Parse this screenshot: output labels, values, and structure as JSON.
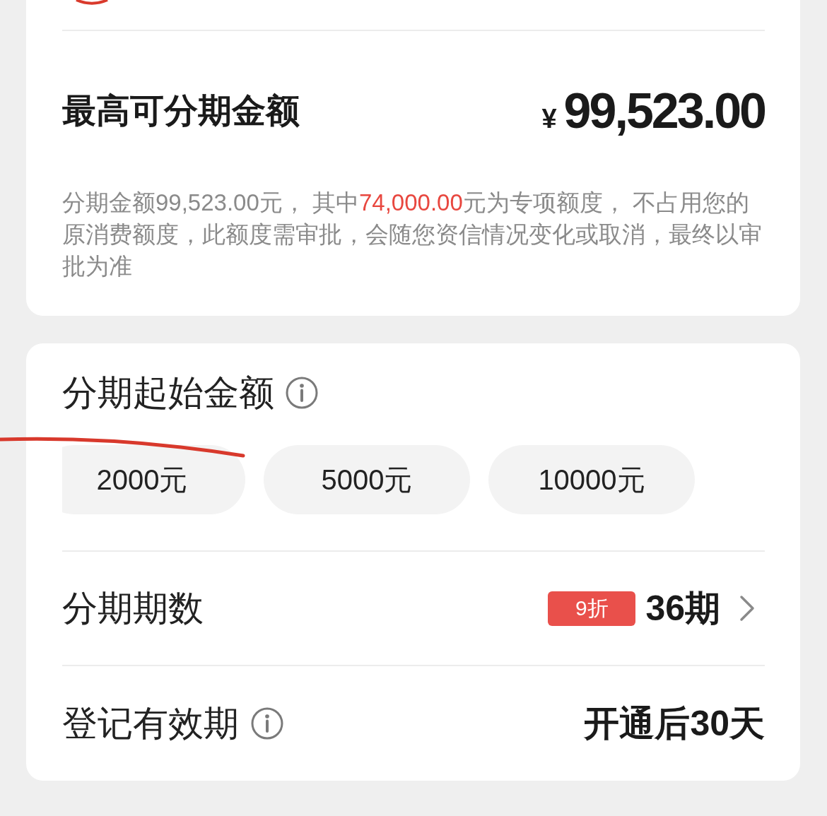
{
  "limit_card": {
    "title": "最高可分期金额",
    "currency": "¥",
    "amount": "99,523.00",
    "note": [
      {
        "text": "分期金额99,523.00元， 其中",
        "highlight": false
      },
      {
        "text": "74,000.00",
        "highlight": true
      },
      {
        "text": "元为专项额度， 不占用您的原消费额度，此额度需审批，会随您资信情况变化或取消，最终以审批为准",
        "highlight": false
      }
    ]
  },
  "start_amount": {
    "title": "分期起始金额",
    "options": [
      {
        "label": "2000元",
        "selected": false
      },
      {
        "label": "5000元",
        "selected": false
      },
      {
        "label": "10000元",
        "selected": false
      }
    ]
  },
  "term": {
    "label": "分期期数",
    "badge": "9折",
    "value": "36期"
  },
  "validity": {
    "label": "登记有效期",
    "value": "开通后30天"
  }
}
